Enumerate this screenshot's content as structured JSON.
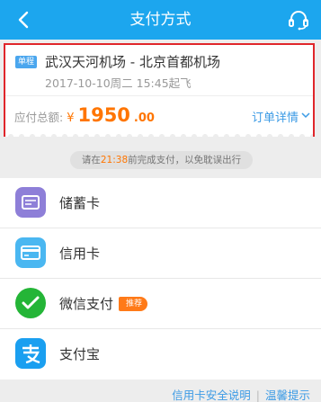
{
  "header": {
    "title": "支付方式",
    "back_icon": "back-arrow-icon",
    "service_icon": "customer-service-icon",
    "background": "#1ca6ee"
  },
  "order": {
    "badge": "单程",
    "route": "武汉天河机场 - 北京首都机场",
    "departure": "2017-10-10周二 15:45起飞",
    "amount_label": "应付总额:",
    "currency": "¥",
    "amount_integer": "1950",
    "amount_decimal": ".00",
    "details_link": "订单详情"
  },
  "notice": {
    "prefix": "请在",
    "deadline": "21:38",
    "suffix": "前完成支付，以免耽误出行"
  },
  "payment_methods": [
    {
      "label": "储蓄卡",
      "icon": "debit-card-icon",
      "color": "#8e7fd8"
    },
    {
      "label": "信用卡",
      "icon": "credit-card-icon",
      "color": "#4ab7f1"
    },
    {
      "label": "微信支付",
      "icon": "wechat-pay-icon",
      "color": "#24b537",
      "badge": "推荐"
    },
    {
      "label": "支付宝",
      "icon": "alipay-icon",
      "color": "#1a9ff0"
    }
  ],
  "footer": {
    "security_link": "信用卡安全说明",
    "separator": "|",
    "tips_link": "温馨提示"
  },
  "colors": {
    "accent": "#1ca6ee",
    "price": "#ff7500",
    "highlight_border": "#e0262b",
    "link": "#3c9be5"
  }
}
